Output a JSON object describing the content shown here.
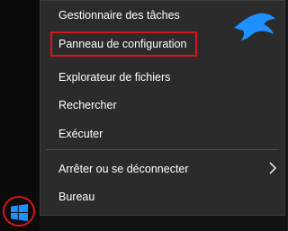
{
  "context_menu": {
    "items": [
      {
        "label": "Gestionnaire des tâches"
      },
      {
        "label": "Panneau de configuration"
      },
      {
        "label": "Explorateur de fichiers"
      },
      {
        "label": "Rechercher"
      },
      {
        "label": "Exécuter"
      },
      {
        "label": "Arrêter ou se déconnecter",
        "has_submenu": true
      },
      {
        "label": "Bureau"
      }
    ],
    "highlighted_item": "Panneau de configuration",
    "background_color": "#2b2b2b",
    "text_color": "#ffffff"
  },
  "annotations": {
    "highlight_color": "#d7141a"
  },
  "logo": {
    "icon": "bird-logo-icon",
    "color": "#1e90ff"
  },
  "taskbar": {
    "start_button_icon": "windows-logo-icon",
    "accent_color": "#1e90ff"
  }
}
